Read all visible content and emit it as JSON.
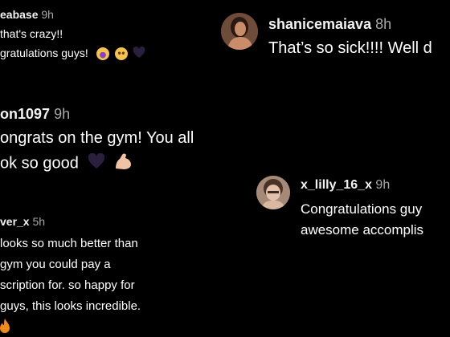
{
  "comments": [
    {
      "username": "eabase",
      "time": "9h",
      "lines": [
        "that's crazy!!",
        "gratulations guys!"
      ],
      "emojis": [
        "shocked-face-emoji",
        "pleading-face-emoji",
        "purple-heart-emoji"
      ]
    },
    {
      "username": "on1097",
      "time": "9h",
      "lines": [
        "ongrats on the gym! You all",
        "ok so good"
      ],
      "emojis": [
        "purple-heart-emoji",
        "flexed-biceps-emoji"
      ]
    },
    {
      "username": "ver_x",
      "time": "5h",
      "lines": [
        "looks so much better than",
        "gym you could pay a",
        "scription for. so happy for",
        "guys, this looks incredible."
      ],
      "emojis": [
        "fire-emoji"
      ]
    },
    {
      "username": "shanicemaiava",
      "time": "8h",
      "lines": [
        "That’s so sick!!!! Well d"
      ]
    },
    {
      "username": "x_lilly_16_x",
      "time": "9h",
      "lines": [
        "Congratulations guy",
        "awesome accomplis"
      ]
    }
  ]
}
